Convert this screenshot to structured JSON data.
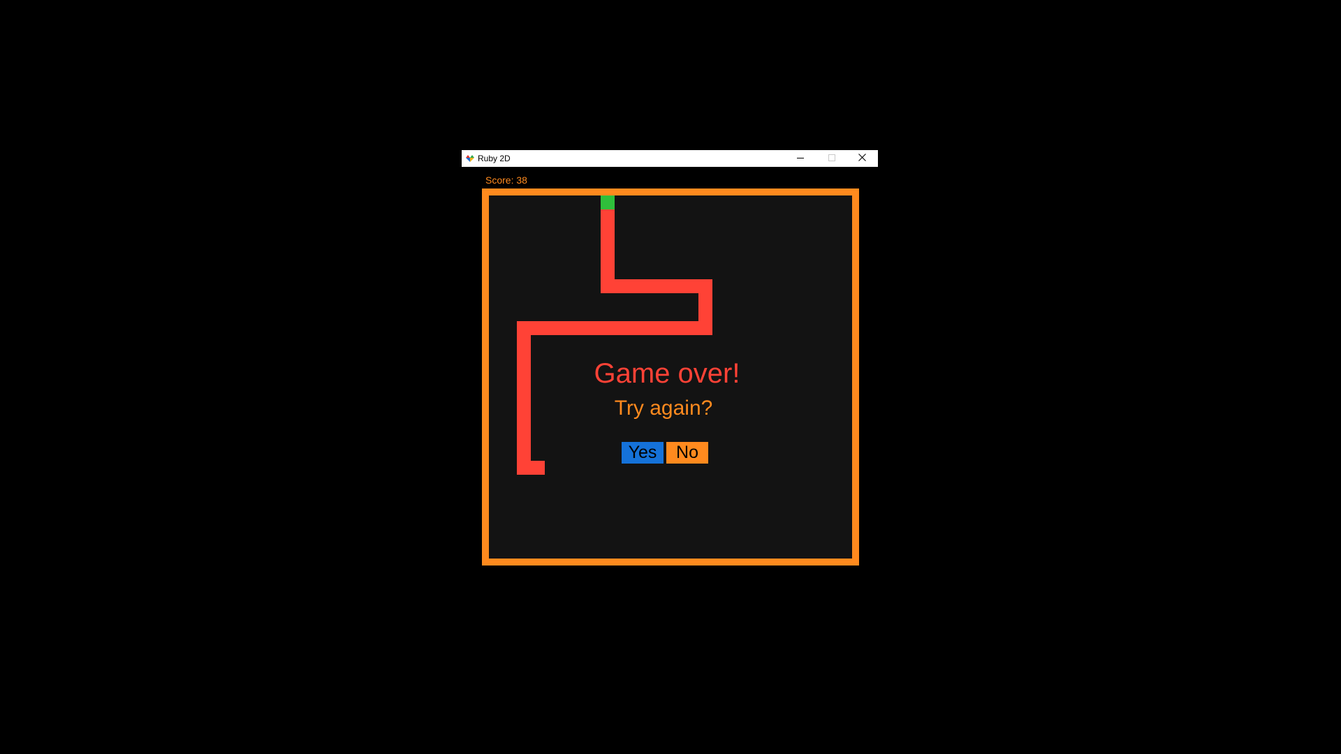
{
  "window": {
    "title": "Ruby 2D"
  },
  "game": {
    "score_text": "Score: 38",
    "game_over_text": "Game over!",
    "try_again_text": "Try again?",
    "yes_label": "Yes",
    "no_label": "No"
  },
  "colors": {
    "border": "#ff8a1e",
    "board": "#131313",
    "snake": "#ff4236",
    "food": "#2fbf3b",
    "yes_button": "#1572d9",
    "no_button": "#ff8a1e"
  },
  "icons": {
    "app": "ruby-2d-app-icon",
    "minimize": "minimize-icon",
    "maximize": "maximize-icon",
    "close": "close-icon"
  }
}
